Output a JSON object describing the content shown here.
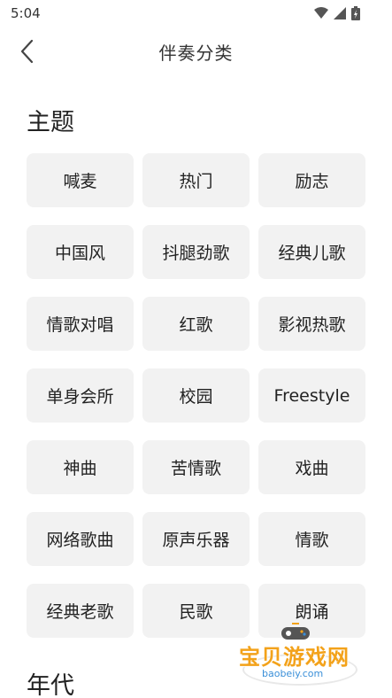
{
  "status_bar": {
    "time": "5:04"
  },
  "header": {
    "title": "伴奏分类"
  },
  "sections": {
    "theme": {
      "title": "主题",
      "items": [
        "喊麦",
        "热门",
        "励志",
        "中国风",
        "抖腿劲歌",
        "经典儿歌",
        "情歌对唱",
        "红歌",
        "影视热歌",
        "单身会所",
        "校园",
        "Freestyle",
        "神曲",
        "苦情歌",
        "戏曲",
        "网络歌曲",
        "原声乐器",
        "情歌",
        "经典老歌",
        "民歌",
        "朗诵"
      ]
    },
    "era": {
      "title": "年代"
    }
  },
  "watermark": {
    "name": "宝贝游戏网",
    "url": "baobeiy.com"
  },
  "colors": {
    "chip_bg": "#f2f2f2",
    "text": "#222222",
    "watermark_orange": "#f3a21a",
    "watermark_blue": "#3a8fd8"
  }
}
